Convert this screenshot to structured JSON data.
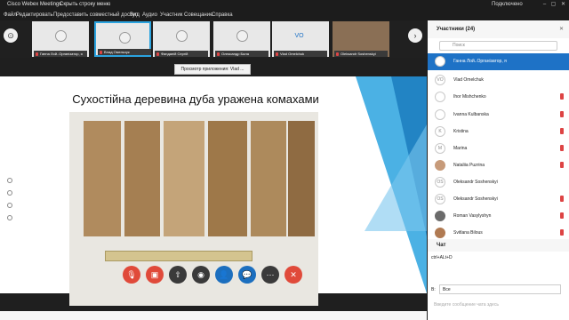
{
  "window": {
    "title": "Cisco Webex Meetings",
    "hide_menu": "Скрыть строку меню",
    "connected": "Подключено"
  },
  "menu": [
    "Файл",
    "Редактировать",
    "Предоставить совместный доступ",
    "Вид",
    "Аудио",
    "Участник",
    "Совещание",
    "Справка"
  ],
  "filmstrip": [
    {
      "name": "Ганна Лой..Організатор, я",
      "initials": ""
    },
    {
      "name": "Влад Омельчук",
      "initials": ""
    },
    {
      "name": "Фанданій Сергій",
      "initials": ""
    },
    {
      "name": "Олександр Бала",
      "initials": ""
    },
    {
      "name": "Vlad Omelchuk",
      "initials": "VO"
    },
    {
      "name": "Oleksandr Soshenskyi",
      "initials": ""
    }
  ],
  "share": {
    "viewer_button": "Просмотр приложения: Vlad ..."
  },
  "slide": {
    "title": "Сухостійна деревина дуба уражена комахами"
  },
  "participants": {
    "header": "Участники (24)",
    "search_placeholder": "Поиск",
    "list": [
      {
        "name": "Ганна Лой..Організатор, я",
        "initials": ""
      },
      {
        "name": "Vlad Omelchuk",
        "initials": "VO"
      },
      {
        "name": "Ihor Mishchenko",
        "initials": ""
      },
      {
        "name": "Ivanna Kulbanska",
        "initials": ""
      },
      {
        "name": "Kristina",
        "initials": "K"
      },
      {
        "name": "Marina",
        "initials": "M"
      },
      {
        "name": "Nataliia Puzrina",
        "initials": ""
      },
      {
        "name": "Oleksandr Soshenskyi",
        "initials": "OS"
      },
      {
        "name": "Oleksandr Soshenskyi",
        "initials": "OS"
      },
      {
        "name": "Roman Vasylyshyn",
        "initials": ""
      },
      {
        "name": "Svitlana Bilous",
        "initials": ""
      }
    ]
  },
  "chat": {
    "header": "Чат",
    "message": "ctrl+ALt+D",
    "to_label": "В:",
    "to_value": "Все",
    "input_placeholder": "Введите сообщение чата здесь"
  },
  "colors": {
    "accent": "#1e72c6",
    "mute_red": "#e04a3a",
    "control_blue": "#1c6fbf"
  }
}
